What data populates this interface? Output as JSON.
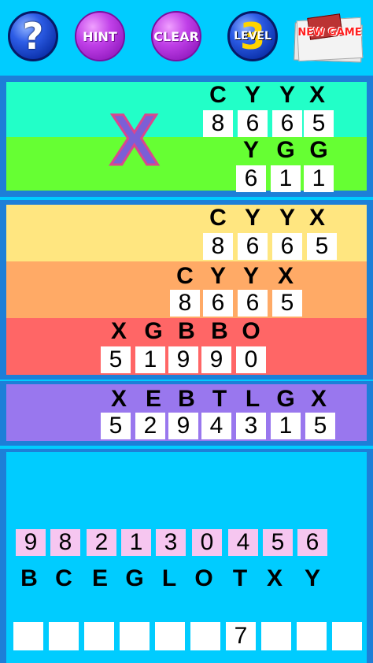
{
  "toolbar": {
    "help_label": "?",
    "hint_label": "HINT",
    "clear_label": "CLEAR",
    "level_label": "LEVEL",
    "level_number": "3",
    "new_game_label": "NEW GAME"
  },
  "feedback_mark": "X",
  "group1": {
    "row1": {
      "letters": [
        "C",
        "Y",
        "Y",
        "X"
      ],
      "digits": [
        "8",
        "6",
        "6",
        "5"
      ]
    },
    "row2": {
      "letters": [
        "Y",
        "G",
        "G"
      ],
      "digits": [
        "6",
        "1",
        "1"
      ]
    }
  },
  "group2": {
    "row1": {
      "letters": [
        "C",
        "Y",
        "Y",
        "X"
      ],
      "digits": [
        "8",
        "6",
        "6",
        "5"
      ]
    },
    "row2": {
      "letters": [
        "C",
        "Y",
        "Y",
        "X"
      ],
      "digits": [
        "8",
        "6",
        "6",
        "5"
      ]
    },
    "row3": {
      "letters": [
        "X",
        "G",
        "B",
        "B",
        "O"
      ],
      "digits": [
        "5",
        "1",
        "9",
        "9",
        "0"
      ]
    }
  },
  "group3": {
    "row1": {
      "letters": [
        "X",
        "E",
        "B",
        "T",
        "L",
        "G",
        "X"
      ],
      "digits": [
        "5",
        "2",
        "9",
        "4",
        "3",
        "1",
        "5"
      ]
    }
  },
  "digit_pool": [
    "9",
    "8",
    "2",
    "1",
    "3",
    "0",
    "4",
    "5",
    "6"
  ],
  "letter_pool": [
    "B",
    "C",
    "E",
    "G",
    "L",
    "O",
    "T",
    "X",
    "Y"
  ],
  "answer_slots": [
    "",
    "",
    "",
    "",
    "",
    "",
    "7",
    "",
    "",
    ""
  ],
  "colors": {
    "background": "#00ccff",
    "frame": "#1d7fd8",
    "row_aqua": "#22ffc8",
    "row_green": "#66ff33",
    "row_yellow": "#ffe680",
    "row_orange": "#ffaa66",
    "row_red": "#ff6666",
    "row_purple": "#9977ee",
    "digit_tile_pink": "#f6c6f0"
  }
}
